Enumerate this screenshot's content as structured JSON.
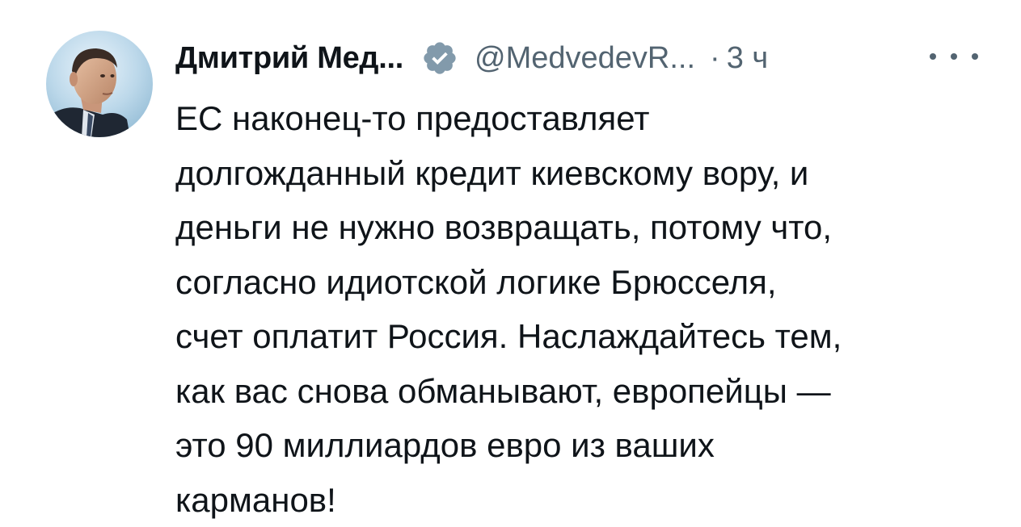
{
  "tweet": {
    "author": {
      "display_name": "Дмитрий Мед...",
      "handle": "@MedvedevR...",
      "verified": true,
      "avatar_icon": "user-avatar-photo",
      "verified_icon": "verified-badge-icon"
    },
    "separator": "·",
    "timestamp": "3 ч",
    "more_icon": "more-options-icon",
    "text_lines": [
      "ЕС наконец-то предоставляет",
      "долгожданный кредит киевскому вору, и",
      "деньги не нужно возвращать, потому что,",
      "согласно идиотской логике Брюсселя,",
      "счет оплатит Россия. Наслаждайтесь тем,",
      "как вас снова обманывают, европейцы —",
      "это 90 миллиардов евро из ваших",
      "карманов!"
    ]
  },
  "colors": {
    "primary_text": "#0f1419",
    "secondary_text": "#536471",
    "verified_badge": "#829aab",
    "background": "#ffffff"
  }
}
